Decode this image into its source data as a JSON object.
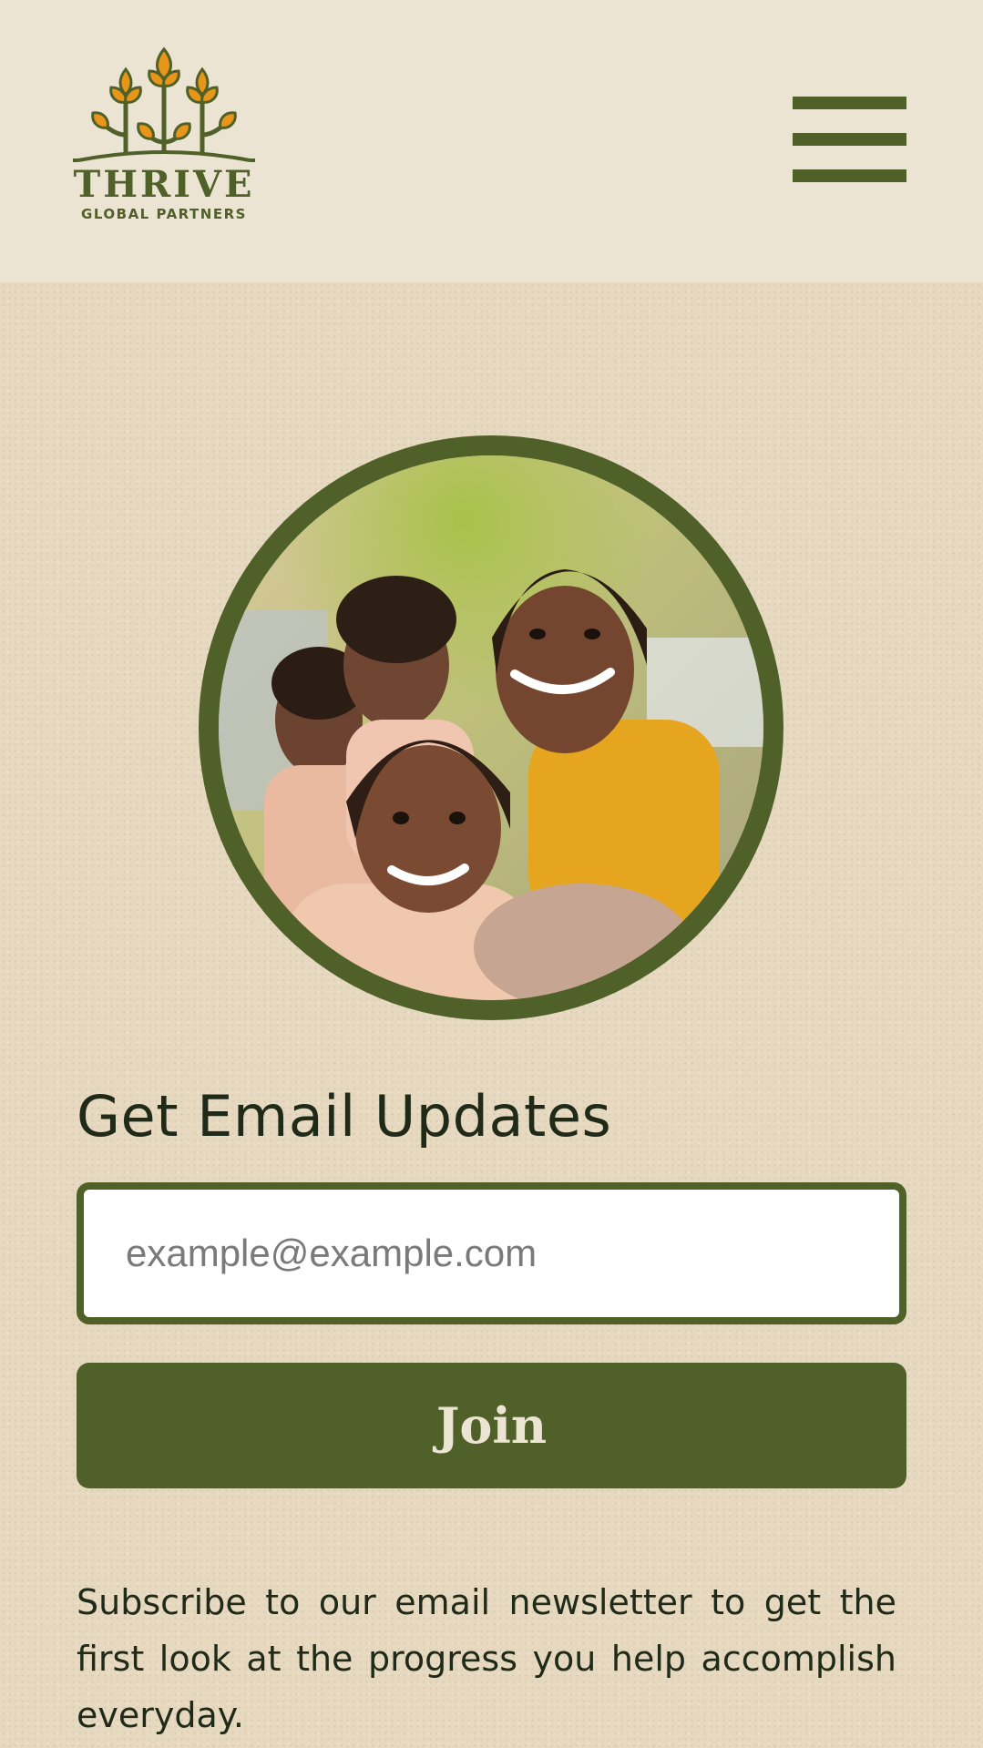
{
  "header": {
    "logo": {
      "name": "THRIVE",
      "tagline": "GLOBAL PARTNERS",
      "icon": "sprouting-plants-icon"
    },
    "menu_icon": "hamburger-menu-icon"
  },
  "colors": {
    "brand_green": "#4f6028",
    "header_bg": "#ece4d2",
    "page_bg": "#e6d9bf",
    "logo_orange": "#e8961a",
    "text_dark": "#1f2a19"
  },
  "hero": {
    "image_alt": "smiling-children-photo"
  },
  "signup": {
    "heading": "Get Email Updates",
    "email_placeholder": "example@example.com",
    "email_value": "",
    "join_label": "Join",
    "description": "Subscribe to our email newsletter to get the first look at the progress you help accomplish everyday."
  }
}
